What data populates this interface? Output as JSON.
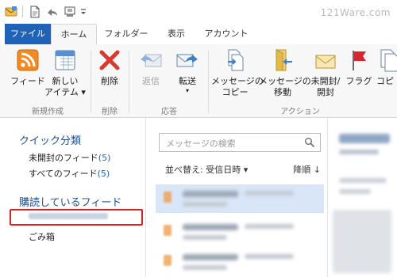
{
  "titlebar": {
    "watermark": "121Ware.com"
  },
  "tabs": [
    {
      "label": "ファイル"
    },
    {
      "label": "ホーム"
    },
    {
      "label": "フォルダー"
    },
    {
      "label": "表示"
    },
    {
      "label": "アカウント"
    }
  ],
  "ribbon": {
    "groups": {
      "new": "新規作成",
      "delete": "削除",
      "respond": "応答",
      "actions": "アクション"
    },
    "buttons": {
      "feed": "フィード",
      "new_item_line1": "新しい",
      "new_item_line2": "アイテム ▾",
      "delete": "削除",
      "reply": "返信",
      "forward": "転送",
      "forward_arrow": "▾",
      "copy_line1": "メッセージの",
      "copy_line2": "コピー",
      "move_line1": "メッセージの",
      "move_line2": "移動",
      "unread_line1": "未開封/",
      "unread_line2": "開封",
      "flag": "フラグ",
      "more": "コピ"
    }
  },
  "sidebar": {
    "quick_views_heading": "クイック分類",
    "unread_feeds_label": "未開封のフィード",
    "unread_feeds_count": "(5)",
    "all_feeds_label": "すべてのフィード",
    "all_feeds_count": "(5)",
    "subscribed_heading": "購読しているフィード",
    "trash": "ごみ箱"
  },
  "message_list": {
    "search_placeholder": "メッセージの検索",
    "sort_by": "並べ替え: 受信日時 ▾",
    "sort_order": "降順 ↓"
  },
  "colors": {
    "accent": "#1e63b8",
    "heading": "#1e4f8f",
    "highlight_box": "#e02020",
    "selected_row": "#d8e6f7"
  }
}
